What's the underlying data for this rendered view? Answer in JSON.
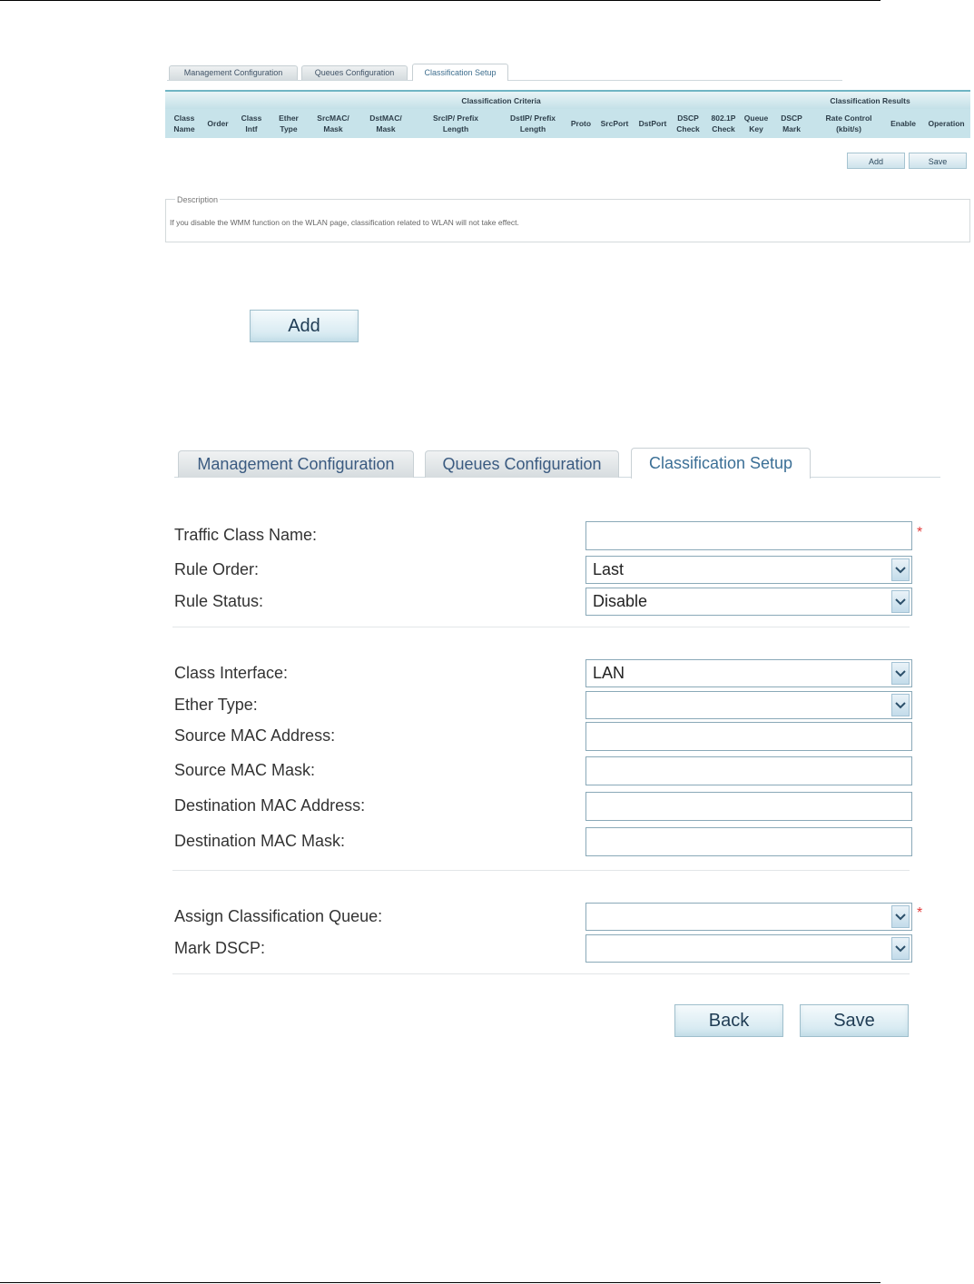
{
  "small_tabs": [
    "Management Configuration",
    "Queues Configuration",
    "Classification Setup"
  ],
  "criteria_header": "Classification Criteria",
  "results_header": "Classification Results",
  "columns": [
    [
      "Class",
      "Name"
    ],
    [
      "Order"
    ],
    [
      "Class",
      "Intf"
    ],
    [
      "Ether",
      "Type"
    ],
    [
      "SrcMAC/",
      "Mask"
    ],
    [
      "DstMAC/",
      "Mask"
    ],
    [
      "SrcIP/ Prefix",
      "Length"
    ],
    [
      "DstIP/ Prefix",
      "Length"
    ],
    [
      "Proto"
    ],
    [
      "SrcPort"
    ],
    [
      "DstPort"
    ],
    [
      "DSCP",
      "Check"
    ],
    [
      "802.1P",
      "Check"
    ],
    [
      "Queue",
      "Key"
    ],
    [
      "DSCP",
      "Mark"
    ],
    [
      "Rate Control",
      "(kbit/s)"
    ],
    [
      "Enable"
    ],
    [
      "Operation"
    ]
  ],
  "small_buttons": {
    "add": "Add",
    "save": "Save"
  },
  "description": {
    "legend": "Description",
    "text": "If you disable the WMM function on the WLAN page, classification related to WLAN will not take effect."
  },
  "add_button": "Add",
  "tabs": [
    "Management Configuration",
    "Queues Configuration",
    "Classification Setup"
  ],
  "form": {
    "traffic_class_name": {
      "label": "Traffic Class Name:",
      "value": ""
    },
    "rule_order": {
      "label": "Rule Order:",
      "value": "Last"
    },
    "rule_status": {
      "label": "Rule Status:",
      "value": "Disable"
    },
    "class_interface": {
      "label": "Class Interface:",
      "value": "LAN"
    },
    "ether_type": {
      "label": "Ether Type:",
      "value": ""
    },
    "source_mac_address": {
      "label": "Source MAC Address:",
      "value": ""
    },
    "source_mac_mask": {
      "label": "Source MAC Mask:",
      "value": ""
    },
    "destination_mac_address": {
      "label": "Destination MAC Address:",
      "value": ""
    },
    "destination_mac_mask": {
      "label": "Destination MAC Mask:",
      "value": ""
    },
    "assign_classification_queue": {
      "label": "Assign Classification Queue:",
      "value": ""
    },
    "mark_dscp": {
      "label": "Mark DSCP:",
      "value": ""
    },
    "required_mark": "*"
  },
  "buttons": {
    "back": "Back",
    "save": "Save"
  },
  "colors": {
    "required": "#e23a3a",
    "tab_text": "#3a5a80",
    "table_header": "#c7e3ea"
  }
}
